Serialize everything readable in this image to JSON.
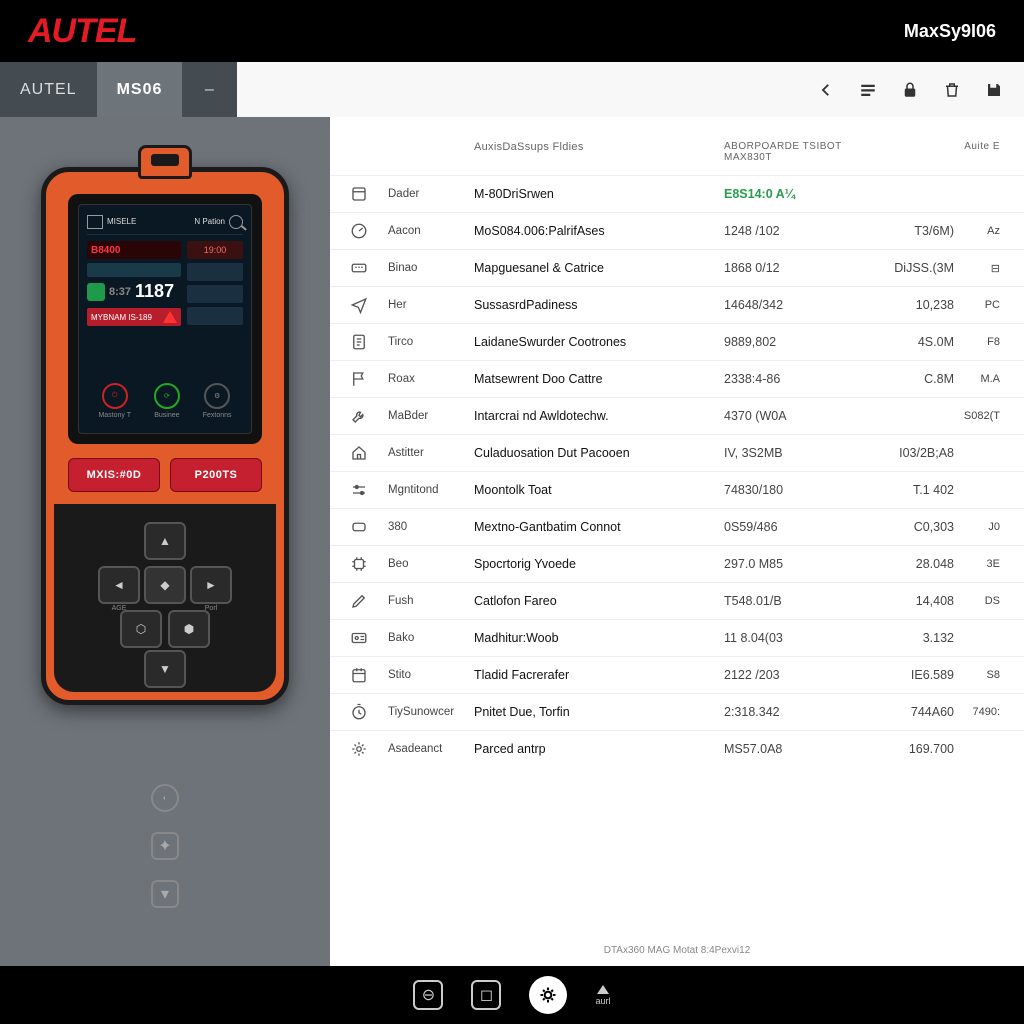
{
  "header": {
    "logo": "AUTEL",
    "model": "MaxSy9I06"
  },
  "tabs": {
    "t1": "AUTEL",
    "t2": "MS06",
    "t3": "–"
  },
  "device": {
    "screen_label_left": "MISELE",
    "screen_label_mid": "N Pation",
    "screen_red1": "B8400",
    "screen_chip1": "19:00",
    "screen_big": "1187",
    "screen_big_prefix": "8:37",
    "screen_strip": "MYBNAM IS-189",
    "circle1": "Mastony T",
    "circle2": "Businee",
    "circle3": "Fextonns",
    "btn1": "MXIS:#0D",
    "btn2": "P200TS",
    "pad_l": "AGE",
    "pad_r": "Porl"
  },
  "table": {
    "title": "AuxisDaSsups Fldies",
    "h2": "ABORPOARDE TSIBOT MAX830T",
    "h3": "Auite E",
    "rows": [
      {
        "icon": "box",
        "c2": "Dader",
        "c3": "M-80DriSrwen",
        "c4": "E8S14:0 A¼",
        "c5": "",
        "c6": "",
        "green": true
      },
      {
        "icon": "gauge",
        "c2": "Aacon",
        "c3": "MoS084.006:PalrifAses",
        "c4": "1248 /102",
        "c5": "T3/6M)",
        "c6": "Az"
      },
      {
        "icon": "obd",
        "c2": "Binao",
        "c3": "Mapguesanel & Catrice",
        "c4": "1868 0/12",
        "c5": "DiJSS.(3M",
        "c6": "⊟"
      },
      {
        "icon": "send",
        "c2": "Her",
        "c3": "SussasrdPadiness",
        "c4": "14648/342",
        "c5": "10,238",
        "c6": "PC"
      },
      {
        "icon": "doc",
        "c2": "Tirco",
        "c3": "LaidaneSwurder Cootrones",
        "c4": "9889,802",
        "c5": "4S.0M",
        "c6": "F8"
      },
      {
        "icon": "flag",
        "c2": "Roax",
        "c3": "Matsewrent Doo Cattre",
        "c4": "2338:4-86",
        "c5": "C.8M",
        "c6": "M.A"
      },
      {
        "icon": "wrench",
        "c2": "MaBder",
        "c3": "Intarcrai nd Awldotechw.",
        "c4": "4370 (W0A",
        "c5": "",
        "c6": "S082(T"
      },
      {
        "icon": "home",
        "c2": "Astitter",
        "c3": "Culaduosation Dut Pacooen",
        "c4": "IV, 3S2MB",
        "c5": "I03/2B;A8",
        "c6": ""
      },
      {
        "icon": "slider",
        "c2": "Mgntitond",
        "c3": "Moontolk Toat",
        "c4": "74830/180",
        "c5": "T.1 402",
        "c6": ""
      },
      {
        "icon": "rect",
        "c2": "380",
        "c3": "Mextno-Gantbatim Connot",
        "c4": "0S59/486",
        "c5": "C0,303",
        "c6": "J0"
      },
      {
        "icon": "chip",
        "c2": "Beo",
        "c3": "Spocrtorig Yvoede",
        "c4": "297.0 M85",
        "c5": "28.048",
        "c6": "3E"
      },
      {
        "icon": "pen",
        "c2": "Fush",
        "c3": "Catlofon Fareo",
        "c4": "T548.01/B",
        "c5": "14,408",
        "c6": "DS"
      },
      {
        "icon": "id",
        "c2": "Bako",
        "c3": "Madhitur:Woob",
        "c4": "11 8.04(03",
        "c5": "3.132",
        "c6": ""
      },
      {
        "icon": "cal",
        "c2": "Stito",
        "c3": "Tladid Facrerafer",
        "c4": "2122 /203",
        "c5": "IE6.589",
        "c6": "S8"
      },
      {
        "icon": "timer",
        "c2": "TiySunowcer",
        "c3": "Pnitet Due, Torfin",
        "c4": "2:318.342",
        "c5": "744A60",
        "c6": "7490:"
      },
      {
        "icon": "cog",
        "c2": "Asadeanct",
        "c3": "Parced antrp",
        "c4": "MS57.0A8",
        "c5": "169.700",
        "c6": ""
      }
    ]
  },
  "footer_label": "DTAx360 MAG Motat 8:4Pexvi12",
  "bottom_label": "aurl"
}
